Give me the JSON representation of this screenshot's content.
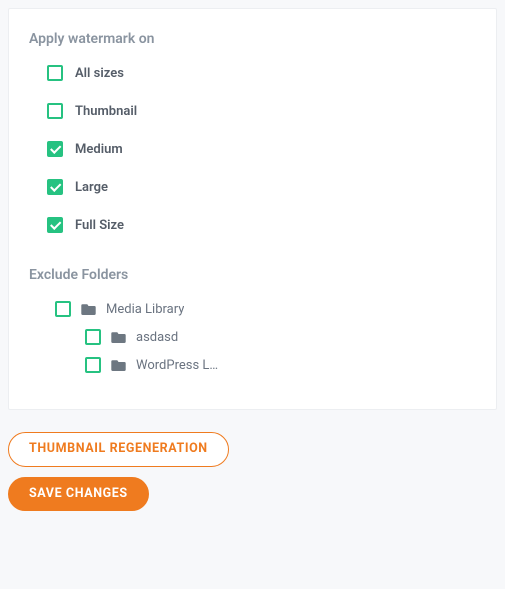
{
  "panel": {
    "apply": {
      "title": "Apply watermark on",
      "options": [
        {
          "label": "All sizes",
          "checked": false
        },
        {
          "label": "Thumbnail",
          "checked": false
        },
        {
          "label": "Medium",
          "checked": true
        },
        {
          "label": "Large",
          "checked": true
        },
        {
          "label": "Full Size",
          "checked": true
        }
      ]
    },
    "exclude": {
      "title": "Exclude Folders",
      "root": {
        "label": "Media Library",
        "checked": false,
        "children": [
          {
            "label": "asdasd",
            "checked": false
          },
          {
            "label": "WordPress L…",
            "checked": false
          }
        ]
      }
    }
  },
  "actions": {
    "regen": "Thumbnail Regeneration",
    "save": "Save Changes"
  }
}
